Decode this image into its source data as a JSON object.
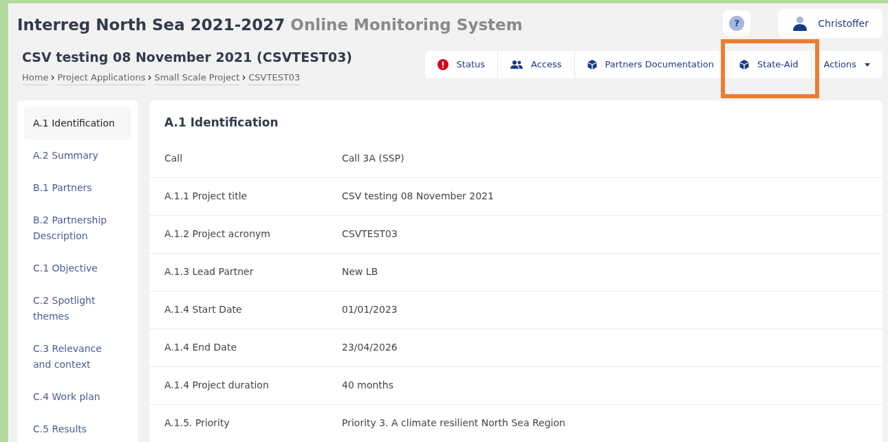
{
  "header": {
    "title": "Interreg North Sea 2021-2027",
    "subtitle": "Online Monitoring System",
    "help": "?",
    "user": "Christoffer"
  },
  "project": {
    "title": "CSV testing 08 November 2021 (CSVTEST03)",
    "breadcrumbs": [
      "Home",
      "Project Applications",
      "Small Scale Project",
      "CSVTEST03"
    ]
  },
  "toolbar": [
    {
      "label": "Status",
      "kind": "alert"
    },
    {
      "label": "Access",
      "kind": "users"
    },
    {
      "label": "Partners Documentation",
      "kind": "box"
    },
    {
      "label": "State-Aid",
      "kind": "box"
    },
    {
      "label": "Actions",
      "kind": "dropdown"
    }
  ],
  "sidebar": {
    "items": [
      {
        "label": "A.1 Identification",
        "selected": true
      },
      {
        "label": "A.2 Summary",
        "selected": false
      },
      {
        "label": "B.1 Partners",
        "selected": false
      },
      {
        "label": "B.2 Partnership Description",
        "selected": false
      },
      {
        "label": "C.1 Objective",
        "selected": false
      },
      {
        "label": "C.2 Spotlight themes",
        "selected": false
      },
      {
        "label": "C.3 Relevance and context",
        "selected": false
      },
      {
        "label": "C.4 Work plan",
        "selected": false
      },
      {
        "label": "C.5 Results",
        "selected": false
      }
    ]
  },
  "section": {
    "heading": "A.1 Identification",
    "rows": [
      {
        "label": "Call",
        "value": "Call 3A (SSP)"
      },
      {
        "label": "A.1.1 Project title",
        "value": "CSV testing 08 November 2021"
      },
      {
        "label": "A.1.2 Project acronym",
        "value": "CSVTEST03"
      },
      {
        "label": "A.1.3 Lead Partner",
        "value": "New LB"
      },
      {
        "label": "A.1.4 Start Date",
        "value": "01/01/2023"
      },
      {
        "label": "A.1.4 End Date",
        "value": "23/04/2026"
      },
      {
        "label": "A.1.4 Project duration",
        "value": "40 months"
      },
      {
        "label": "A.1.5. Priority",
        "value": "Priority 3. A climate resilient North Sea Region"
      }
    ]
  }
}
